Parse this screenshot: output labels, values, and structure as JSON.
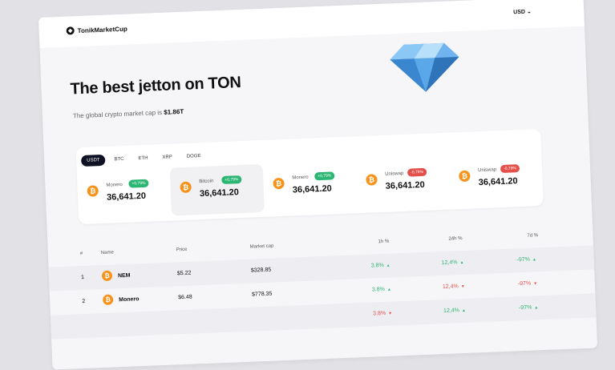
{
  "brand": {
    "name": "TonikMarketCup"
  },
  "header": {
    "currency": "USD"
  },
  "hero": {
    "title": "The best jetton on TON",
    "subtitle_prefix": "The global crypto market cap is",
    "market_cap": "$1.86T"
  },
  "tabs": [
    "USDT",
    "BTC",
    "ETH",
    "XRP",
    "DOGE"
  ],
  "tickers": [
    {
      "name": "Monero",
      "change": "+0,79%",
      "dir": "up",
      "value": "36,641.20"
    },
    {
      "name": "Bitcoin",
      "change": "+0,79%",
      "dir": "up",
      "value": "36,641.20"
    },
    {
      "name": "Monero",
      "change": "+0,79%",
      "dir": "up",
      "value": "36,641.20"
    },
    {
      "name": "Uniswap",
      "change": "-0,79%",
      "dir": "down",
      "value": "36,641.20"
    },
    {
      "name": "Uniswap",
      "change": "-0,79%",
      "dir": "down",
      "value": "36,641.20"
    }
  ],
  "table": {
    "headers": {
      "num": "#",
      "name": "Name",
      "price": "Price",
      "cap": "Market cap",
      "h1": "1h %",
      "h24": "24h %",
      "d7": "7d %"
    },
    "rows": [
      {
        "num": "1",
        "name": "NEM",
        "price": "$5.22",
        "cap": "$328.85",
        "h1": "3.8%",
        "h1dir": "up",
        "h24": "12,4%",
        "h24dir": "up",
        "d7": "-97%",
        "d7dir": "up"
      },
      {
        "num": "2",
        "name": "Monero",
        "price": "$6.48",
        "cap": "$778.35",
        "h1": "3.8%",
        "h1dir": "up",
        "h24": "12,4%",
        "h24dir": "down",
        "d7": "-97%",
        "d7dir": "down"
      },
      {
        "num": "",
        "name": "",
        "price": "",
        "cap": "",
        "h1": "3.8%",
        "h1dir": "down",
        "h24": "12,4%",
        "h24dir": "up",
        "d7": "-97%",
        "d7dir": "up"
      }
    ]
  }
}
